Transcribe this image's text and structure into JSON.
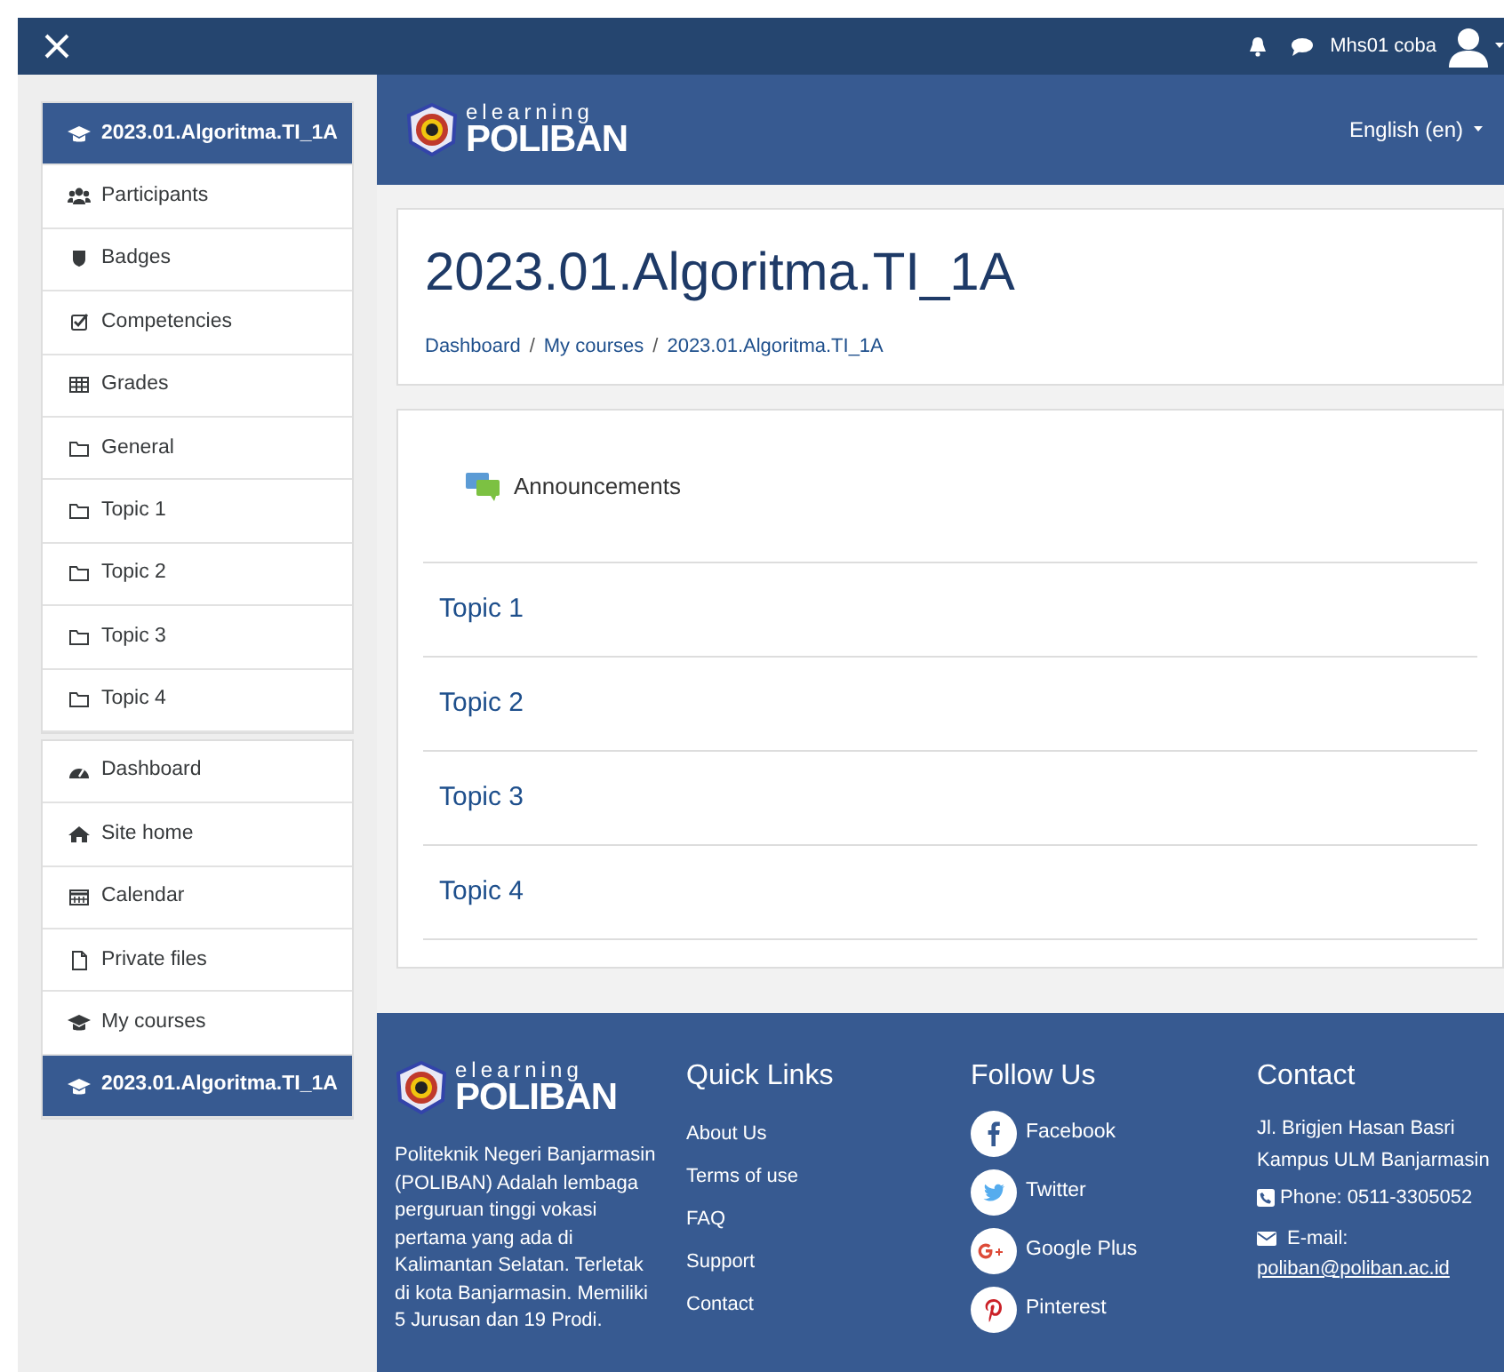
{
  "navbar": {
    "user_name": "Mhs01 coba"
  },
  "sidebar": {
    "groups": [
      {
        "items": [
          {
            "label": "2023.01.Algoritma.TI_1A",
            "selected": true
          },
          {
            "label": "Participants",
            "selected": false
          },
          {
            "label": "Badges",
            "selected": false
          },
          {
            "label": "Competencies",
            "selected": false
          },
          {
            "label": "Grades",
            "selected": false
          },
          {
            "label": "General",
            "selected": false
          },
          {
            "label": "Topic 1",
            "selected": false
          },
          {
            "label": "Topic 2",
            "selected": false
          },
          {
            "label": "Topic 3",
            "selected": false
          },
          {
            "label": "Topic 4",
            "selected": false
          }
        ]
      },
      {
        "items": [
          {
            "label": "Dashboard",
            "selected": false
          },
          {
            "label": "Site home",
            "selected": false
          },
          {
            "label": "Calendar",
            "selected": false
          },
          {
            "label": "Private files",
            "selected": false
          },
          {
            "label": "My courses",
            "selected": false
          },
          {
            "label": "2023.01.Algoritma.TI_1A",
            "selected": true
          }
        ]
      }
    ]
  },
  "header": {
    "logo_top": "elearning",
    "logo_bottom": "POLIBAN",
    "language": "English (en)"
  },
  "course": {
    "title": "2023.01.Algoritma.TI_1A",
    "breadcrumb": [
      "Dashboard",
      "My courses",
      "2023.01.Algoritma.TI_1A"
    ],
    "breadcrumb_separator": "/"
  },
  "content": {
    "activity": "Announcements",
    "topics": [
      "Topic 1",
      "Topic 2",
      "Topic 3",
      "Topic 4"
    ]
  },
  "footer": {
    "logo_top": "elearning",
    "logo_bottom": "POLIBAN",
    "about": "Politeknik Negeri Banjarmasin (POLIBAN) Adalah lembaga perguruan tinggi vokasi pertama yang ada di Kalimantan Selatan. Terletak di kota Banjarmasin. Memiliki 5 Jurusan dan 19 Prodi.",
    "quick_links_title": "Quick Links",
    "quick_links": [
      "About Us",
      "Terms of use",
      "FAQ",
      "Support",
      "Contact"
    ],
    "follow_title": "Follow Us",
    "social": [
      "Facebook",
      "Twitter",
      "Google Plus",
      "Pinterest"
    ],
    "contact_title": "Contact",
    "address_lines": [
      "Jl. Brigjen Hasan Basri",
      "Kampus ULM Banjarmasin"
    ],
    "phone": "Phone: 0511-3305052",
    "email_label": "E-mail:",
    "email": "poliban@poliban.ac.id"
  }
}
